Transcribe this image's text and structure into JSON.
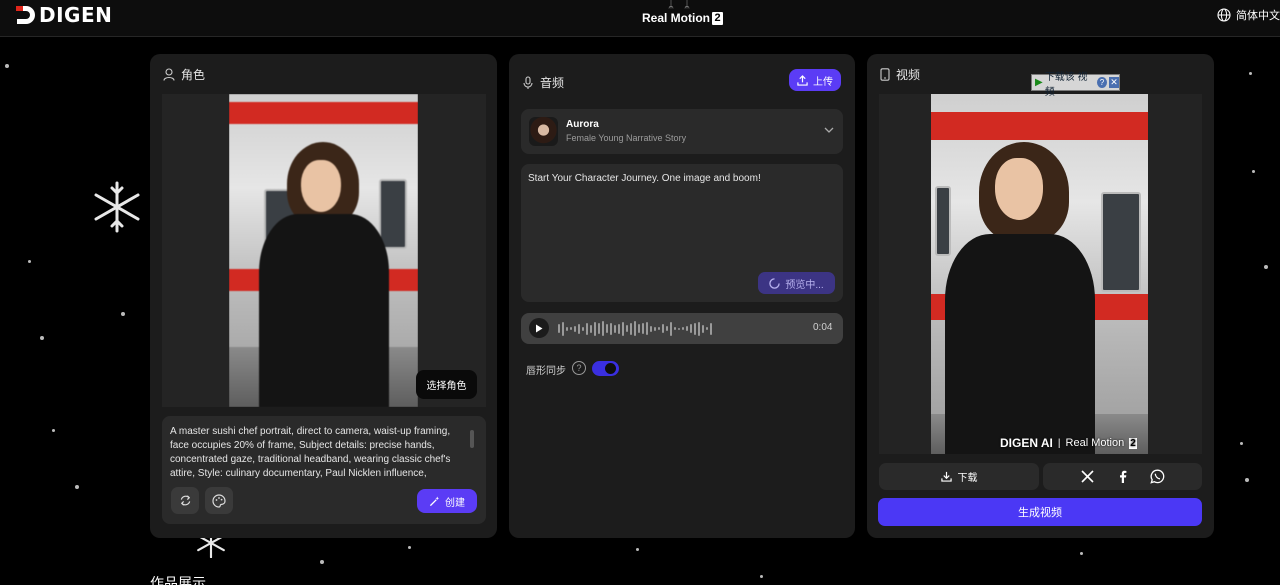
{
  "header": {
    "logo_text": "DIGEN",
    "center_brand": "Real Motion",
    "center_badge": "2",
    "language": "简体中文"
  },
  "character_panel": {
    "title": "角色",
    "choose_button": "选择角色",
    "prompt": "A master sushi chef portrait, direct to camera, waist-up framing, face occupies 20% of frame, Subject details: precise hands, concentrated gaze, traditional headband, wearing classic chef's attire, Style: culinary documentary, Paul Nicklen influence,",
    "create_button": "创建"
  },
  "audio_panel": {
    "title": "音频",
    "upload_button": "上传",
    "voice_name": "Aurora",
    "voice_desc": "Female Young Narrative Story",
    "script_text": "Start Your Character Journey. One image and boom!",
    "preview_button": "预览中...",
    "duration": "0:04",
    "sync_label": "唇形同步",
    "sync_enabled": true
  },
  "video_panel": {
    "title": "视频",
    "download_overlay": "下载该 视频",
    "watermark_logo": "DIGEN AI",
    "watermark_brand": "Real Motion",
    "watermark_badge": "2",
    "download_button": "下载",
    "generate_button": "生成视频"
  },
  "gallery_title": "作品展示",
  "colors": {
    "accent": "#5b3cf5",
    "generate": "#4b38f5",
    "panel": "#1c1c1c"
  }
}
